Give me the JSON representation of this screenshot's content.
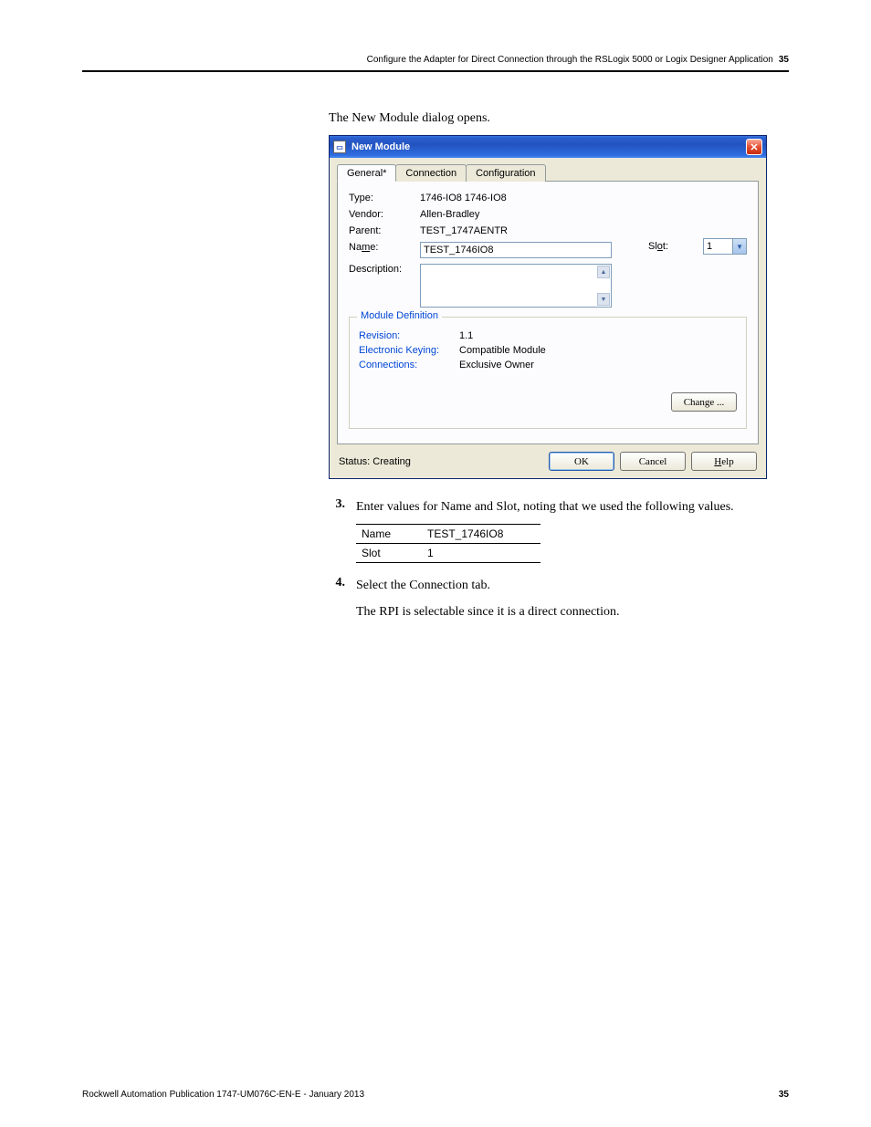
{
  "header": {
    "chapter": "Configure the Adapter for Direct Connection through the RSLogix 5000 or Logix Designer Application",
    "page_no": "35"
  },
  "intro": "The New Module dialog opens.",
  "dialog": {
    "title": "New Module",
    "tabs": {
      "general": "General*",
      "connection": "Connection",
      "configuration": "Configuration"
    },
    "labels": {
      "type": "Type:",
      "vendor": "Vendor:",
      "parent": "Parent:",
      "name": "Name:",
      "description": "Description:",
      "slot": "Slot:"
    },
    "values": {
      "type": "1746-IO8 1746-IO8",
      "vendor": "Allen-Bradley",
      "parent": "TEST_1747AENTR",
      "name": "TEST_1746IO8",
      "slot": "1"
    },
    "module_def": {
      "legend": "Module Definition",
      "revision_k": "Revision:",
      "revision_v": "1.1",
      "ek_k": "Electronic Keying:",
      "ek_v": "Compatible Module",
      "conn_k": "Connections:",
      "conn_v": "Exclusive Owner",
      "change_btn": "Change ..."
    },
    "status_label": "Status: Creating",
    "buttons": {
      "ok": "OK",
      "cancel": "Cancel",
      "help": "Help"
    }
  },
  "step3": {
    "num": "3.",
    "text": "Enter values for Name and Slot, noting that we used the following values.",
    "table": {
      "r1k": "Name",
      "r1v": "TEST_1746IO8",
      "r2k": "Slot",
      "r2v": "1"
    }
  },
  "step4": {
    "num": "4.",
    "line1": "Select the Connection tab.",
    "line2": "The RPI is selectable since it is a direct connection."
  },
  "footer": {
    "pub": "Rockwell Automation Publication 1747-UM076C-EN-E - January 2013",
    "page_no": "35"
  }
}
